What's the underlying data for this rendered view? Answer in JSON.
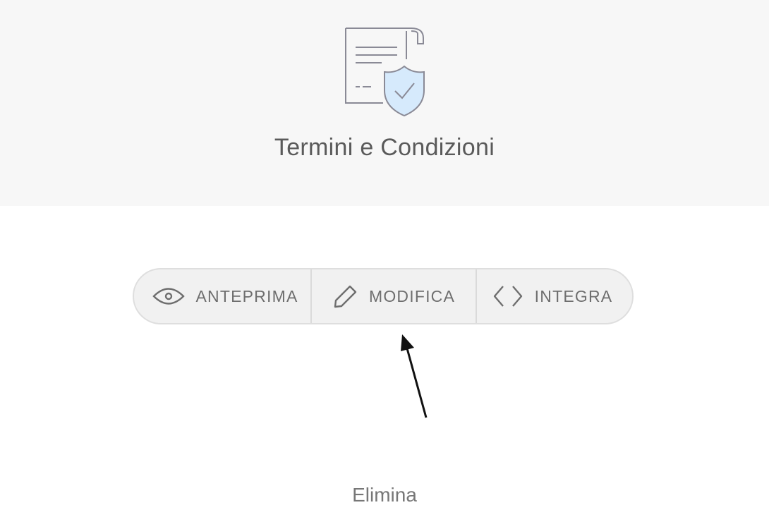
{
  "header": {
    "title": "Termini e Condizioni",
    "icon": "document-shield-icon"
  },
  "actions": {
    "preview": {
      "label": "ANTEPRIMA",
      "icon": "eye-icon"
    },
    "edit": {
      "label": "MODIFICA",
      "icon": "pencil-icon"
    },
    "embed": {
      "label": "INTEGRA",
      "icon": "code-icon"
    }
  },
  "delete_label": "Elimina",
  "colors": {
    "header_bg": "#f7f7f7",
    "text": "#5a5a5a",
    "button_bg": "#f1f1f1",
    "shield_fill": "#d6eafc"
  }
}
